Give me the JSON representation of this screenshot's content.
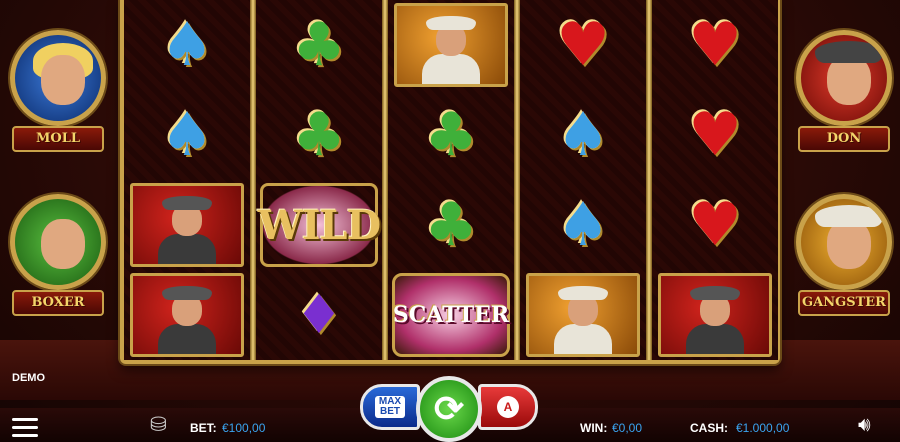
{
  "game": {
    "mode_label": "DEMO"
  },
  "portraits": {
    "left": [
      {
        "name": "MOLL",
        "icon": "moll-portrait-icon"
      },
      {
        "name": "BOXER",
        "icon": "boxer-portrait-icon"
      }
    ],
    "right": [
      {
        "name": "DON",
        "icon": "don-portrait-icon"
      },
      {
        "name": "GANGSTER",
        "icon": "gangster-portrait-icon"
      }
    ]
  },
  "reels": [
    [
      "spade",
      "spade",
      "mobster-red",
      "mobster-red"
    ],
    [
      "club",
      "club",
      "wild",
      "diamond"
    ],
    [
      "gangster-gold",
      "club",
      "club",
      "scatter"
    ],
    [
      "heart",
      "spade",
      "spade",
      "gangster-gold"
    ],
    [
      "heart",
      "heart",
      "heart",
      "mobster-red"
    ]
  ],
  "symbols": {
    "wild_text": "WILD",
    "scatter_text": "SCATTER"
  },
  "controls": {
    "max_bet_line1": "MAX",
    "max_bet_line2": "BET",
    "spin_glyph": "⟳",
    "auto_glyph": "A"
  },
  "status": {
    "bet_label": "BET:",
    "bet_value": "€100,00",
    "win_label": "WIN:",
    "win_value": "€0,00",
    "cash_label": "CASH:",
    "cash_value": "€1.000,00"
  },
  "colors": {
    "accent_blue": "#3aa4f0",
    "frame_gold": "#c9a24a",
    "spin_green": "#3aa82a",
    "max_bet_blue": "#1a4ab0",
    "auto_red": "#c81a1a"
  }
}
